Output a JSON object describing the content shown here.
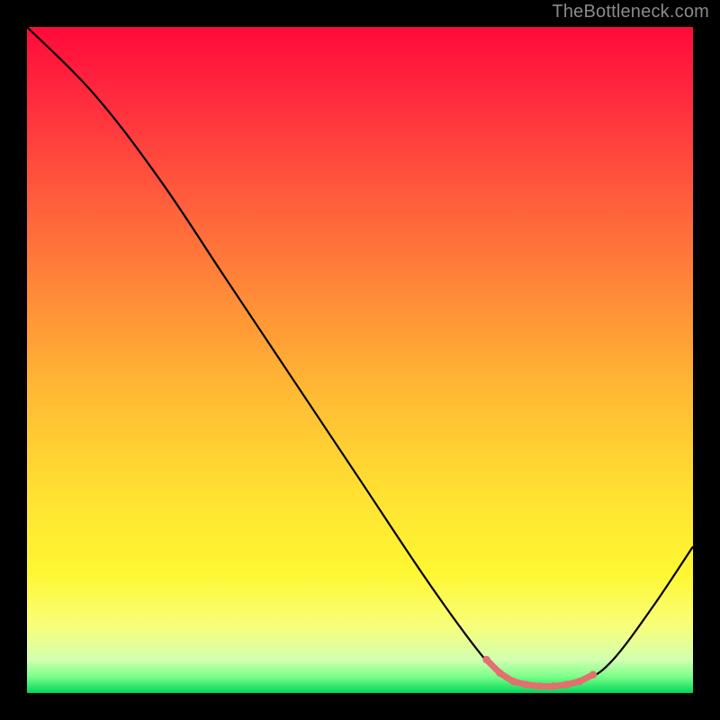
{
  "attribution": "TheBottleneck.com",
  "chart_data": {
    "type": "line",
    "title": "",
    "xlabel": "",
    "ylabel": "",
    "xlim": [
      0,
      100
    ],
    "ylim": [
      0,
      100
    ],
    "grid": false,
    "curve": {
      "name": "bottleneck-curve",
      "color": "#000000",
      "points": [
        {
          "x": 0,
          "y": 100
        },
        {
          "x": 10,
          "y": 90
        },
        {
          "x": 20,
          "y": 77
        },
        {
          "x": 30,
          "y": 62
        },
        {
          "x": 40,
          "y": 47
        },
        {
          "x": 50,
          "y": 32
        },
        {
          "x": 60,
          "y": 17
        },
        {
          "x": 68,
          "y": 6
        },
        {
          "x": 72,
          "y": 2
        },
        {
          "x": 76,
          "y": 1
        },
        {
          "x": 80,
          "y": 1
        },
        {
          "x": 84,
          "y": 2
        },
        {
          "x": 88,
          "y": 5
        },
        {
          "x": 94,
          "y": 13
        },
        {
          "x": 100,
          "y": 22
        }
      ]
    },
    "sweet_spot_markers": {
      "name": "optimal-range",
      "color": "#e36f6f",
      "x_values": [
        69,
        71,
        73,
        75,
        77,
        79,
        81,
        83,
        85
      ]
    },
    "gradient_bands": [
      {
        "y": 100,
        "color": "#ff0a3a"
      },
      {
        "y": 85,
        "color": "#ff3c3c"
      },
      {
        "y": 70,
        "color": "#ff6a3a"
      },
      {
        "y": 55,
        "color": "#ff9838"
      },
      {
        "y": 40,
        "color": "#ffc236"
      },
      {
        "y": 28,
        "color": "#ffe234"
      },
      {
        "y": 18,
        "color": "#fff232"
      },
      {
        "y": 10,
        "color": "#fbff6e"
      },
      {
        "y": 4,
        "color": "#d8ffb0"
      },
      {
        "y": 0,
        "color": "#00e05a"
      }
    ]
  }
}
